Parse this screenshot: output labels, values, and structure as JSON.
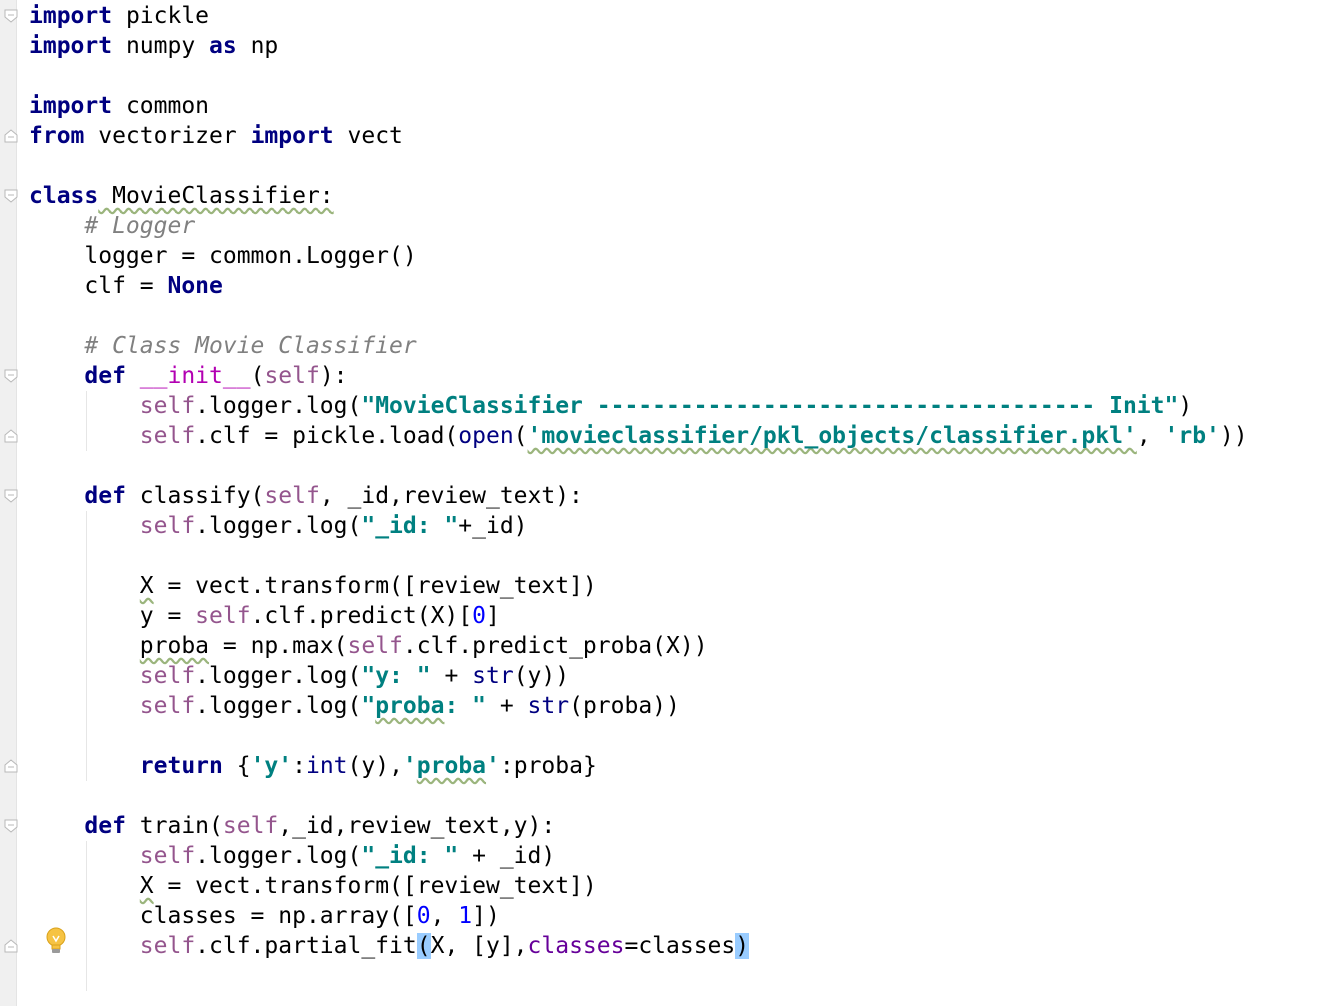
{
  "editor": {
    "language": "python",
    "current_line": 32,
    "lines": [
      [
        {
          "t": "import",
          "c": "kw"
        },
        {
          "t": " pickle",
          "c": ""
        }
      ],
      [
        {
          "t": "import",
          "c": "kw"
        },
        {
          "t": " numpy ",
          "c": ""
        },
        {
          "t": "as",
          "c": "kw"
        },
        {
          "t": " np",
          "c": ""
        }
      ],
      [],
      [
        {
          "t": "import",
          "c": "kw"
        },
        {
          "t": " common",
          "c": ""
        }
      ],
      [
        {
          "t": "from",
          "c": "kw"
        },
        {
          "t": " vectorizer ",
          "c": ""
        },
        {
          "t": "import",
          "c": "kw"
        },
        {
          "t": " vect",
          "c": ""
        }
      ],
      [],
      [
        {
          "t": "class",
          "c": "kw"
        },
        {
          "t": " MovieClassifier:",
          "c": "err"
        }
      ],
      [
        {
          "t": "    ",
          "c": ""
        },
        {
          "t": "# Logger",
          "c": "cm"
        }
      ],
      [
        {
          "t": "    logger = common.Logger()",
          "c": ""
        }
      ],
      [
        {
          "t": "    clf = ",
          "c": ""
        },
        {
          "t": "None",
          "c": "kw"
        }
      ],
      [],
      [
        {
          "t": "    ",
          "c": ""
        },
        {
          "t": "# Class Movie Classifier",
          "c": "cm"
        }
      ],
      [
        {
          "t": "    ",
          "c": ""
        },
        {
          "t": "def",
          "c": "kw"
        },
        {
          "t": " ",
          "c": ""
        },
        {
          "t": "__init__",
          "c": "magic"
        },
        {
          "t": "(",
          "c": ""
        },
        {
          "t": "self",
          "c": "self"
        },
        {
          "t": "):",
          "c": ""
        }
      ],
      [
        {
          "t": "        ",
          "c": ""
        },
        {
          "t": "self",
          "c": "self"
        },
        {
          "t": ".logger.log(",
          "c": ""
        },
        {
          "t": "\"MovieClassifier ------------------------------------ Init\"",
          "c": "str"
        },
        {
          "t": ")",
          "c": ""
        }
      ],
      [
        {
          "t": "        ",
          "c": ""
        },
        {
          "t": "self",
          "c": "self"
        },
        {
          "t": ".clf = pickle.load(",
          "c": ""
        },
        {
          "t": "open",
          "c": "builtin"
        },
        {
          "t": "(",
          "c": ""
        },
        {
          "t": "'movieclassifier/pkl_objects/classifier.pkl'",
          "c": "str err"
        },
        {
          "t": ", ",
          "c": ""
        },
        {
          "t": "'rb'",
          "c": "str"
        },
        {
          "t": "))",
          "c": ""
        }
      ],
      [],
      [
        {
          "t": "    ",
          "c": ""
        },
        {
          "t": "def",
          "c": "kw"
        },
        {
          "t": " classify(",
          "c": ""
        },
        {
          "t": "self",
          "c": "self"
        },
        {
          "t": ", _id,review_text):",
          "c": ""
        }
      ],
      [
        {
          "t": "        ",
          "c": ""
        },
        {
          "t": "self",
          "c": "self"
        },
        {
          "t": ".logger.log(",
          "c": ""
        },
        {
          "t": "\"_id: \"",
          "c": "str"
        },
        {
          "t": "+_id)",
          "c": ""
        }
      ],
      [],
      [
        {
          "t": "        ",
          "c": ""
        },
        {
          "t": "X",
          "c": "err"
        },
        {
          "t": " = vect.transform([review_text])",
          "c": ""
        }
      ],
      [
        {
          "t": "        y = ",
          "c": ""
        },
        {
          "t": "self",
          "c": "self"
        },
        {
          "t": ".clf.predict(X)[",
          "c": ""
        },
        {
          "t": "0",
          "c": "num"
        },
        {
          "t": "]",
          "c": ""
        }
      ],
      [
        {
          "t": "        ",
          "c": ""
        },
        {
          "t": "proba",
          "c": "err"
        },
        {
          "t": " = np.max(",
          "c": ""
        },
        {
          "t": "self",
          "c": "self"
        },
        {
          "t": ".clf.predict_proba(X))",
          "c": ""
        }
      ],
      [
        {
          "t": "        ",
          "c": ""
        },
        {
          "t": "self",
          "c": "self"
        },
        {
          "t": ".logger.log(",
          "c": ""
        },
        {
          "t": "\"y: \"",
          "c": "str"
        },
        {
          "t": " + ",
          "c": ""
        },
        {
          "t": "str",
          "c": "builtin"
        },
        {
          "t": "(y))",
          "c": ""
        }
      ],
      [
        {
          "t": "        ",
          "c": ""
        },
        {
          "t": "self",
          "c": "self"
        },
        {
          "t": ".logger.log(",
          "c": ""
        },
        {
          "t": "\"",
          "c": "str"
        },
        {
          "t": "proba",
          "c": "str err"
        },
        {
          "t": ": \"",
          "c": "str"
        },
        {
          "t": " + ",
          "c": ""
        },
        {
          "t": "str",
          "c": "builtin"
        },
        {
          "t": "(proba))",
          "c": ""
        }
      ],
      [],
      [
        {
          "t": "        ",
          "c": ""
        },
        {
          "t": "return",
          "c": "kw"
        },
        {
          "t": " {",
          "c": ""
        },
        {
          "t": "'y'",
          "c": "str"
        },
        {
          "t": ":",
          "c": ""
        },
        {
          "t": "int",
          "c": "builtin"
        },
        {
          "t": "(y),",
          "c": ""
        },
        {
          "t": "'",
          "c": "str"
        },
        {
          "t": "proba",
          "c": "str err"
        },
        {
          "t": "'",
          "c": "str"
        },
        {
          "t": ":proba}",
          "c": ""
        }
      ],
      [],
      [
        {
          "t": "    ",
          "c": ""
        },
        {
          "t": "def",
          "c": "kw"
        },
        {
          "t": " train(",
          "c": ""
        },
        {
          "t": "self",
          "c": "self"
        },
        {
          "t": ",_id,review_text,y):",
          "c": ""
        }
      ],
      [
        {
          "t": "        ",
          "c": ""
        },
        {
          "t": "self",
          "c": "self"
        },
        {
          "t": ".logger.log(",
          "c": ""
        },
        {
          "t": "\"_id: \"",
          "c": "str"
        },
        {
          "t": " + _id)",
          "c": ""
        }
      ],
      [
        {
          "t": "        ",
          "c": ""
        },
        {
          "t": "X",
          "c": "err"
        },
        {
          "t": " = vect.transform([review_text])",
          "c": ""
        }
      ],
      [
        {
          "t": "        classes = np.array([",
          "c": ""
        },
        {
          "t": "0",
          "c": "num"
        },
        {
          "t": ", ",
          "c": ""
        },
        {
          "t": "1",
          "c": "num"
        },
        {
          "t": "])",
          "c": ""
        }
      ],
      [
        {
          "t": "        ",
          "c": ""
        },
        {
          "t": "self",
          "c": "self"
        },
        {
          "t": ".clf.partial_fit",
          "c": ""
        },
        {
          "t": "(",
          "c": "match"
        },
        {
          "t": "X, [y],",
          "c": ""
        },
        {
          "t": "classes",
          "c": "kwarg"
        },
        {
          "t": "=classes",
          "c": ""
        },
        {
          "t": ")",
          "c": "match"
        }
      ]
    ]
  }
}
